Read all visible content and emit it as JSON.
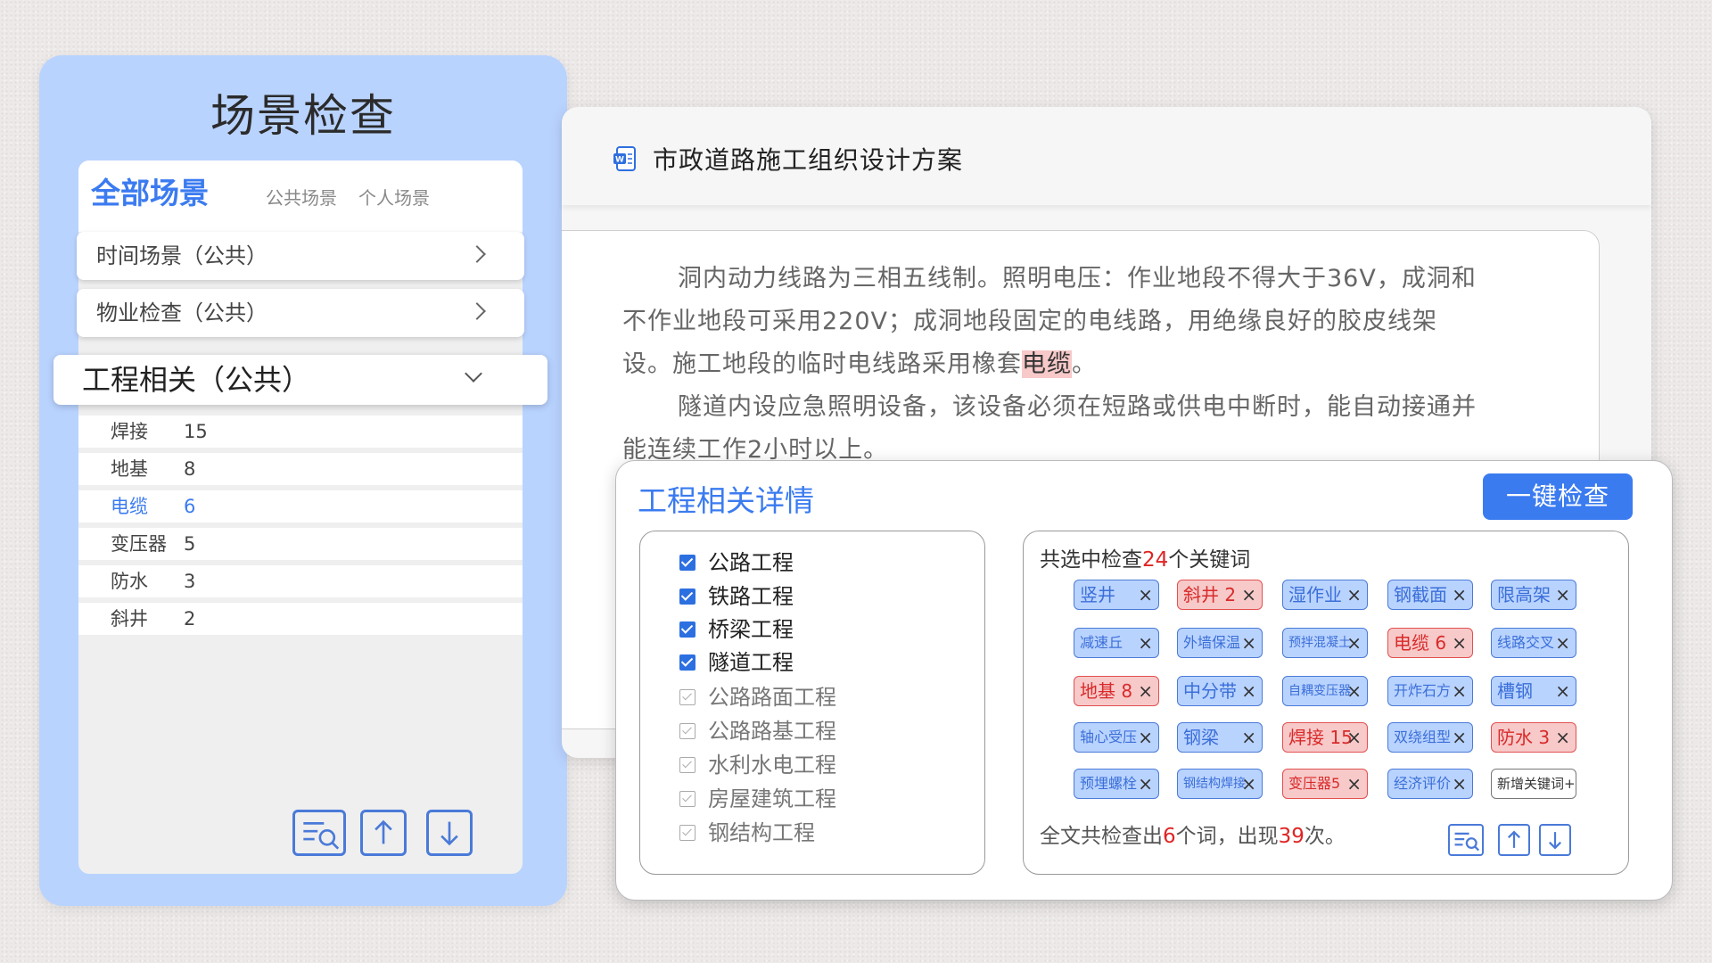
{
  "scene": {
    "title": "场景检查",
    "tabs": {
      "all": "全部场景",
      "public": "公共场景",
      "personal": "个人场景"
    },
    "categories": [
      {
        "label": "时间场景（公共）"
      },
      {
        "label": "物业检查（公共）"
      }
    ],
    "expanded": {
      "label": "工程相关（公共）"
    },
    "keywords": [
      {
        "name": "焊接",
        "count": "15",
        "active": false
      },
      {
        "name": "地基",
        "count": "8",
        "active": false
      },
      {
        "name": "电缆",
        "count": "6",
        "active": true
      },
      {
        "name": "变压器",
        "count": "5",
        "active": false
      },
      {
        "name": "防水",
        "count": "3",
        "active": false
      },
      {
        "name": "斜井",
        "count": "2",
        "active": false
      }
    ],
    "tools": [
      "search-doc-icon",
      "upload-icon",
      "download-icon"
    ]
  },
  "doc": {
    "title": "市政道路施工组织设计方案",
    "para1_a": "洞内动力线路为三相五线制。照明电压：作业地段不得大于36V，成洞和不作业地段可采用220V；成洞地段固定的电线路，用绝缘良好的胶皮线架设。施工地段的临时电线路采用橡套",
    "para1_hl": "电缆",
    "para1_b": "。",
    "para2": "隧道内设应急照明设备，该设备必须在短路或供电中断时，能自动接通并能连续工作2小时以上。"
  },
  "detail": {
    "title": "工程相关详情",
    "check_button": "一键检查",
    "categories": [
      {
        "label": "公路工程",
        "checked": true
      },
      {
        "label": "铁路工程",
        "checked": true
      },
      {
        "label": "桥梁工程",
        "checked": true
      },
      {
        "label": "隧道工程",
        "checked": true
      },
      {
        "label": "公路路面工程",
        "checked": false
      },
      {
        "label": "公路路基工程",
        "checked": false
      },
      {
        "label": "水利水电工程",
        "checked": false
      },
      {
        "label": "房屋建筑工程",
        "checked": false
      },
      {
        "label": "钢结构工程",
        "checked": false
      }
    ],
    "summary_pre": "共选中检查",
    "summary_num": "24",
    "summary_post": "个关键词",
    "chips": [
      [
        "竖井",
        "斜井  2",
        "湿作业",
        "钢截面",
        "限高架"
      ],
      [
        "减速丘",
        "外墙保温",
        "预拌混凝土",
        "电缆  6",
        "线路交叉"
      ],
      [
        "地基  8",
        "中分带",
        "自耦变压器",
        "开炸石方",
        "槽钢"
      ],
      [
        "轴心受压",
        "钢梁",
        "焊接 15",
        "双绕组型",
        "防水  3"
      ],
      [
        "预埋螺栓",
        "钢结构焊接",
        "变压器5",
        "经济评价",
        "新增关键词+"
      ]
    ],
    "chip_remove": "×",
    "result_pre": "全文共检查出",
    "result_words": "6",
    "result_mid": "个词，出现",
    "result_times": "39",
    "result_post": "次。"
  },
  "colors": {
    "accent": "#3b7bf0",
    "panel": "#b9d3ff",
    "hit": "#f7c9c9",
    "alert": "#e02424"
  }
}
